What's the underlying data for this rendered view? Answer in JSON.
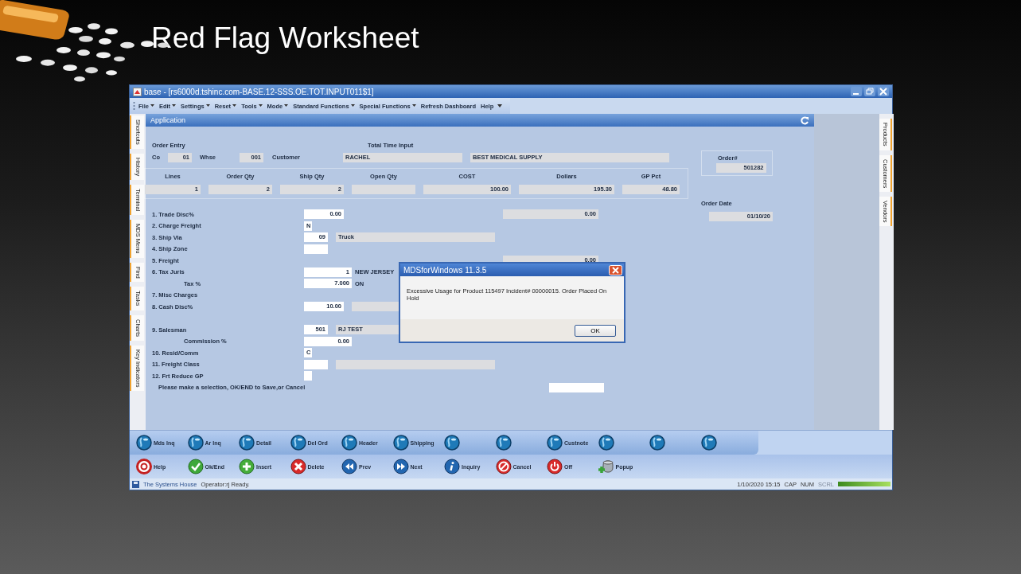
{
  "slide": {
    "title": "Red Flag Worksheet"
  },
  "window": {
    "title": "base - [rs6000d.tshinc.com-BASE.12-SSS.OE.TOT.INPUT011$1]"
  },
  "menu": [
    {
      "label": "File",
      "dropdown": true
    },
    {
      "label": "Edit",
      "dropdown": true
    },
    {
      "label": "Settings",
      "dropdown": true
    },
    {
      "label": "Reset",
      "dropdown": true
    },
    {
      "label": "Tools",
      "dropdown": true
    },
    {
      "label": "Mode",
      "dropdown": true
    },
    {
      "label": "Standard Functions",
      "dropdown": true
    },
    {
      "label": "Special Functions",
      "dropdown": true
    },
    {
      "label": "Refresh Dashboard",
      "dropdown": false
    },
    {
      "label": "Help",
      "dropdown": false
    }
  ],
  "left_tabs": [
    "Shortcuts",
    "History",
    "Terminal",
    "MDS Menu",
    "Find",
    "Tasks",
    "Charts",
    "Key Indicators"
  ],
  "right_tabs": [
    "Products",
    "Customers",
    "Vendors"
  ],
  "panel": {
    "title": "Application"
  },
  "header": {
    "title": "Order Entry",
    "subtitle": "Total Time Input",
    "customer_name": "BEST MEDICAL SUPPLY",
    "fields": [
      {
        "label": "Co",
        "value": "01"
      },
      {
        "label": "Whse",
        "value": "001"
      },
      {
        "label": "Customer",
        "value": "RACHEL"
      }
    ]
  },
  "order": {
    "label": "Order#",
    "value": "501282",
    "date_label": "Order Date",
    "date": "01/10/20"
  },
  "totals": [
    {
      "label": "Lines",
      "value": "1"
    },
    {
      "label": "Order Qty",
      "value": "2"
    },
    {
      "label": "Ship Qty",
      "value": "2"
    },
    {
      "label": "Open Qty"
    },
    {
      "label": "COST",
      "value": "100.00"
    },
    {
      "label": "Dollars",
      "value": "195.30"
    },
    {
      "label": "GP Pct",
      "value": "48.80"
    }
  ],
  "rows": [
    {
      "kind": "item",
      "label": "1. Trade Disc%",
      "field": {
        "kind": "amount",
        "value": "0.00"
      },
      "side": {
        "value": "0.00"
      }
    },
    {
      "kind": "item",
      "label": "2. Charge Freight",
      "field": {
        "kind": "flag",
        "value": "N"
      }
    },
    {
      "kind": "item",
      "label": "3. Ship Via",
      "field": {
        "kind": "code",
        "value": "09"
      },
      "desc": {
        "value": "Truck"
      }
    },
    {
      "kind": "item",
      "label": "4. Ship Zone",
      "field": {
        "kind": "code"
      }
    },
    {
      "kind": "item",
      "label": "5. Freight",
      "side": {
        "value": "0.00"
      }
    },
    {
      "kind": "item",
      "label": "6. Tax Juris",
      "field": {
        "kind": "rate",
        "value": "1"
      },
      "note": "NEW JERSEY",
      "desc": {}
    },
    {
      "kind": "sub",
      "label": "Tax %",
      "field": {
        "kind": "rate",
        "value": "7.000"
      },
      "note": "ON",
      "desc": {}
    },
    {
      "kind": "item",
      "label": "7. Misc Charges"
    },
    {
      "kind": "item",
      "label": "8. Cash Disc%",
      "field": {
        "kind": "amount",
        "value": "10.00"
      },
      "desc": {}
    },
    {
      "kind": "spacer"
    },
    {
      "kind": "item",
      "label": "9. Salesman",
      "field": {
        "kind": "code",
        "value": "501"
      },
      "desc": {
        "value": "RJ TEST"
      }
    },
    {
      "kind": "sub",
      "label": "Commission %",
      "field": {
        "kind": "rate",
        "value": "0.00"
      }
    },
    {
      "kind": "item",
      "label": "10. Resid/Comm",
      "field": {
        "kind": "flag",
        "value": "C"
      }
    },
    {
      "kind": "item",
      "label": "11. Freight Class",
      "field": {
        "kind": "code"
      },
      "desc": {}
    },
    {
      "kind": "item",
      "label": "12. Frt Reduce GP",
      "field": {
        "kind": "flag"
      }
    }
  ],
  "prompt": "Please make a selection, OK/END to Save,or Cancel",
  "dialog": {
    "title": "MDSforWindows 11.3.5",
    "message": "Excessive Usage for Product 115497 Incident# 00000015. Order Placed On Hold",
    "button": "OK"
  },
  "toolbar_top": [
    {
      "kind": "globe",
      "label": "Mds Inq"
    },
    {
      "kind": "globe",
      "label": "Ar Inq"
    },
    {
      "kind": "globe",
      "label": "Detail"
    },
    {
      "kind": "globe",
      "label": "Del Ord"
    },
    {
      "kind": "globe",
      "label": "Header"
    },
    {
      "kind": "globe",
      "label": "Shipping"
    },
    {
      "kind": "globe"
    },
    {
      "kind": "globe"
    },
    {
      "kind": "globe",
      "label": "Custnote"
    },
    {
      "kind": "globe"
    },
    {
      "kind": "globe"
    },
    {
      "kind": "globe"
    }
  ],
  "toolbar_bottom": [
    {
      "kind": "help",
      "label": "Help"
    },
    {
      "kind": "ok",
      "label": "Ok/End"
    },
    {
      "kind": "insert",
      "label": "Insert"
    },
    {
      "kind": "delete",
      "label": "Delete"
    },
    {
      "kind": "prev",
      "label": "Prev"
    },
    {
      "kind": "next",
      "label": "Next"
    },
    {
      "kind": "info",
      "label": "Inquiry"
    },
    {
      "kind": "cancel",
      "label": "Cancel"
    },
    {
      "kind": "power",
      "label": "Off"
    },
    {
      "kind": "database",
      "label": "Popup"
    }
  ],
  "status": {
    "company": "The Systems House",
    "message": "Operator:rj Ready.",
    "datetime": "1/10/2020 15:15",
    "indicators": [
      {
        "label": "CAP",
        "on": true
      },
      {
        "label": "NUM",
        "on": true
      },
      {
        "label": "SCRL",
        "on": false
      }
    ]
  }
}
